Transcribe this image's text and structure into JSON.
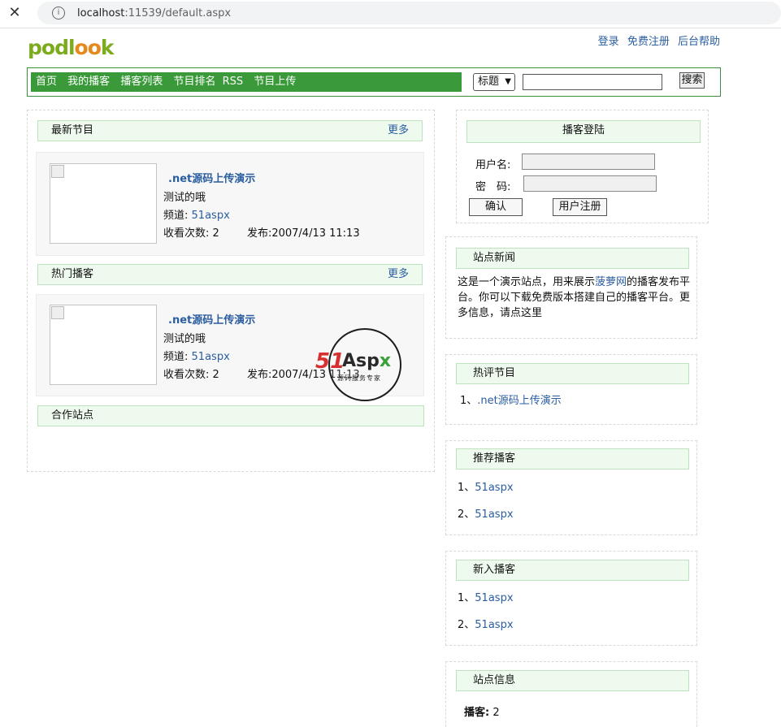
{
  "browser": {
    "url_host": "localhost",
    "url_rest": ":11539/default.aspx"
  },
  "logo": {
    "text_a": "podl",
    "text_b": "oo",
    "text_c": "k"
  },
  "top_links": {
    "login": "登录",
    "register": "免费注册",
    "help": "后台帮助"
  },
  "nav": {
    "items": [
      "首页",
      "我的播客",
      "播客列表",
      "节目排名",
      "RSS",
      "节目上传"
    ],
    "select_value": "标题",
    "search_placeholder": "",
    "search_button": "搜索"
  },
  "latest": {
    "title": "最新节目",
    "more": "更多",
    "episode": {
      "title": ".net源码上传演示",
      "desc": "测试的哦",
      "channel_label": "频道:",
      "channel_value": "51aspx",
      "views_label": "收看次数:",
      "views_value": "2",
      "published_label": "发布:",
      "published_value": "2007/4/13 11:13"
    }
  },
  "hot": {
    "title": "热门播客",
    "more": "更多",
    "episode": {
      "title": ".net源码上传演示",
      "desc": "测试的哦",
      "channel_label": "频道:",
      "channel_value": "51aspx",
      "views_label": "收看次数:",
      "views_value": "2",
      "published_label": "发布:",
      "published_value": "2007/4/13 11:13"
    }
  },
  "partners": {
    "title": "合作站点"
  },
  "login": {
    "title": "播客登陆",
    "username_label": "用户名:",
    "password_label": "密　码:",
    "username_value": "",
    "password_value": "",
    "confirm_button": "确认",
    "register_button": "用户注册"
  },
  "site_news": {
    "title": "站点新闻",
    "text_before": "这是一个演示站点，用来展示",
    "link": "菠萝网",
    "text_after_line1": "的播客发布平",
    "line2": "台。你可以下载免费版本搭建自己的播客平台。更",
    "line3": "多信息，请点这里"
  },
  "hot_comments": {
    "title": "热评节目",
    "items": [
      {
        "index": "1、",
        "label": ".net源码上传演示"
      }
    ]
  },
  "recommended": {
    "title": "推荐播客",
    "items": [
      {
        "index": "1、",
        "label": "51aspx"
      },
      {
        "index": "2、",
        "label": "51aspx"
      }
    ]
  },
  "new_podcasts": {
    "title": "新入播客",
    "items": [
      {
        "index": "1、",
        "label": "51aspx"
      },
      {
        "index": "2、",
        "label": "51aspx"
      }
    ]
  },
  "site_info": {
    "title": "站点信息",
    "podcasts_label": "播客:",
    "podcasts_value": "2"
  },
  "watermark": {
    "brand_num": "51",
    "brand_a": "Asp",
    "brand_x": "x",
    "sub": "源码服务专家"
  },
  "colors": {
    "nav_green": "#3a9a3a",
    "link_blue": "#2a5d9f",
    "header_bg": "#eefaee"
  }
}
